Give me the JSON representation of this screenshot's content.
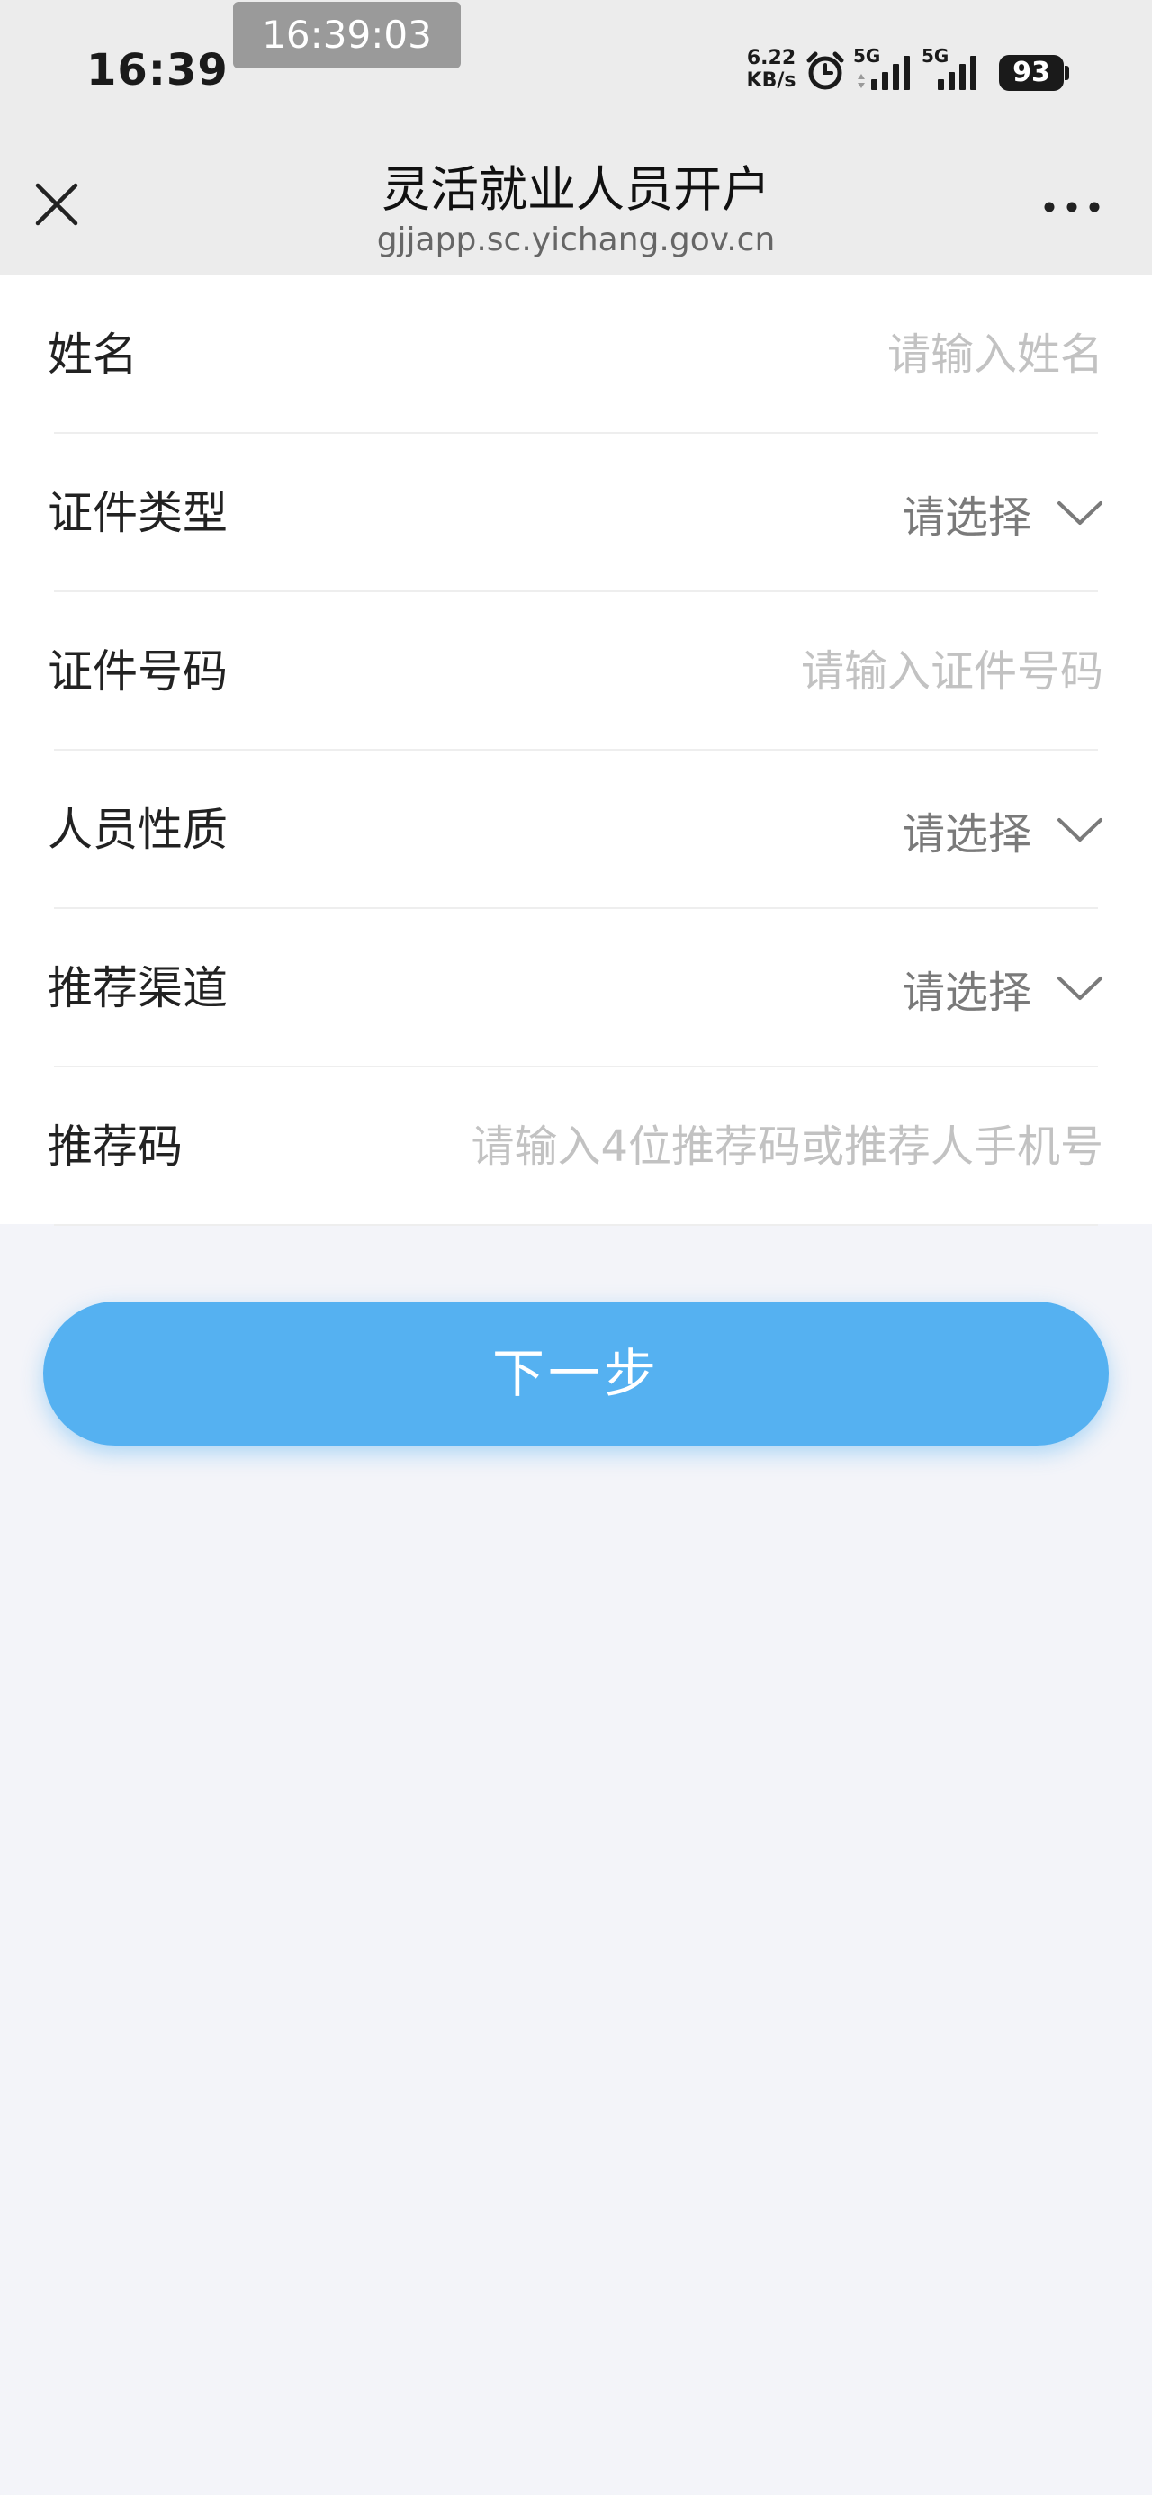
{
  "status_bar": {
    "time": "16:39",
    "screenshot_clock": "16:39:03",
    "net_speed_value": "6.22",
    "net_speed_unit": "KB/s",
    "sim1_label": "5G",
    "sim2_label": "5G",
    "battery": "93",
    "icons": [
      "alarm-icon",
      "signal-icon",
      "battery-icon"
    ]
  },
  "header": {
    "title": "灵活就业人员开户",
    "url": "gjjapp.sc.yichang.gov.cn",
    "icons": [
      "close-icon",
      "more-icon"
    ]
  },
  "form": {
    "name": {
      "label": "姓名",
      "placeholder": "请输入姓名"
    },
    "id_type": {
      "label": "证件类型",
      "value": "请选择"
    },
    "id_number": {
      "label": "证件号码",
      "placeholder": "请输入证件号码"
    },
    "person_type": {
      "label": "人员性质",
      "value": "请选择"
    },
    "channel": {
      "label": "推荐渠道",
      "value": "请选择"
    },
    "referral_code": {
      "label": "推荐码",
      "placeholder": "请输入4位推荐码或推荐人手机号"
    }
  },
  "actions": {
    "next_label": "下一步"
  },
  "colors": {
    "primary": "#55b1f1",
    "page_background": "#f3f4f9",
    "header_background": "#ececec"
  }
}
